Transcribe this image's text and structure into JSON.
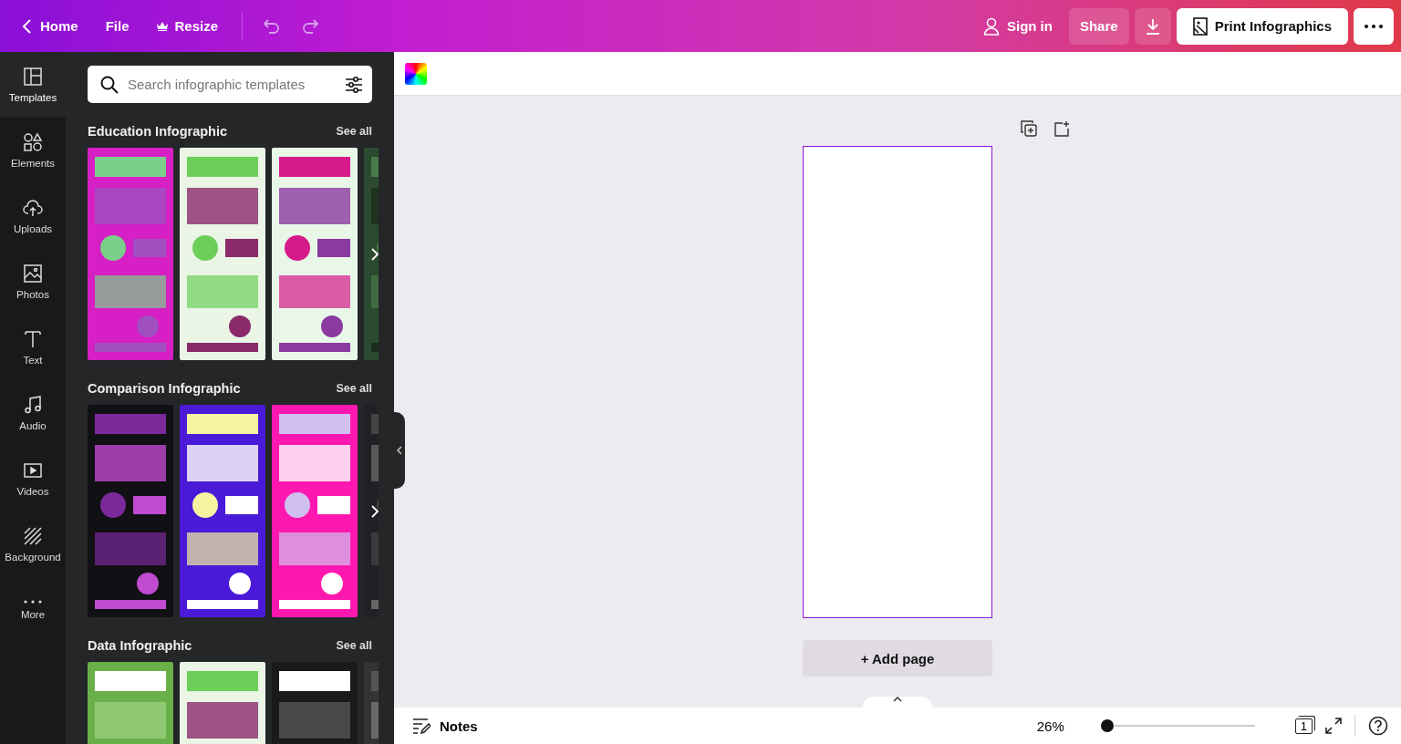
{
  "topbar": {
    "home": "Home",
    "file": "File",
    "resize": "Resize",
    "sign_in": "Sign in",
    "share": "Share",
    "print": "Print Infographics"
  },
  "rail": [
    {
      "label": "Templates",
      "selected": true
    },
    {
      "label": "Elements",
      "selected": false
    },
    {
      "label": "Uploads",
      "selected": false
    },
    {
      "label": "Photos",
      "selected": false
    },
    {
      "label": "Text",
      "selected": false
    },
    {
      "label": "Audio",
      "selected": false
    },
    {
      "label": "Videos",
      "selected": false
    },
    {
      "label": "Background",
      "selected": false
    },
    {
      "label": "More",
      "selected": false
    }
  ],
  "search": {
    "placeholder": "Search infographic templates"
  },
  "sections": [
    {
      "title": "Education Infographic",
      "see_all": "See all",
      "next_button": true
    },
    {
      "title": "Comparison Infographic",
      "see_all": "See all",
      "next_button": true
    },
    {
      "title": "Data Infographic",
      "see_all": "See all"
    }
  ],
  "canvas": {
    "add_page": "+ Add page"
  },
  "bottombar": {
    "notes": "Notes",
    "zoom": "26%",
    "zoom_slider": {
      "level": 0
    },
    "page_count": "1"
  }
}
